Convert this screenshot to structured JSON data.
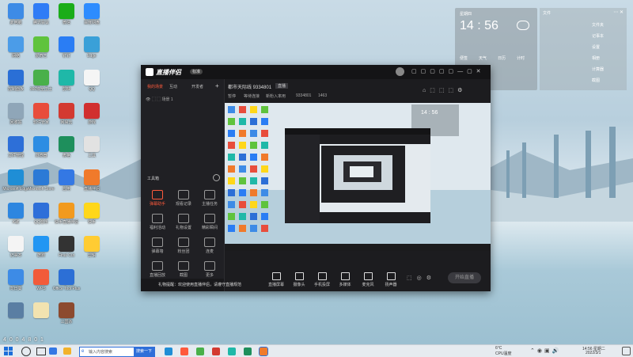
{
  "desktop": {
    "icons": [
      {
        "label": "此电脑",
        "color": "#3d8be6",
        "col": 0,
        "row": 0
      },
      {
        "label": "腾讯会议",
        "color": "#2f7cf6",
        "col": 1,
        "row": 0
      },
      {
        "label": "微信",
        "color": "#1aad19",
        "col": 2,
        "row": 0
      },
      {
        "label": "百度网盘",
        "color": "#2d8cff",
        "col": 3,
        "row": 0
      },
      {
        "label": "网络",
        "color": "#4b9ce8",
        "col": 0,
        "row": 1
      },
      {
        "label": "爱奇艺",
        "color": "#5fc33d",
        "col": 1,
        "row": 1
      },
      {
        "label": "钉钉",
        "color": "#2a7df4",
        "col": 2,
        "row": 1
      },
      {
        "label": "Edge",
        "color": "#3aa0d8",
        "col": 3,
        "row": 1
      },
      {
        "label": "控制面板",
        "color": "#2a6fd6",
        "col": 0,
        "row": 2
      },
      {
        "label": "360安全卫士",
        "color": "#49b04a",
        "col": 1,
        "row": 2
      },
      {
        "label": "剪映",
        "color": "#1fb8a8",
        "col": 2,
        "row": 2
      },
      {
        "label": "QQ",
        "color": "#f5f5f5",
        "col": 3,
        "row": 2
      },
      {
        "label": "回收站",
        "color": "#8fa6b8",
        "col": 0,
        "row": 3
      },
      {
        "label": "软件管家",
        "color": "#e84d3c",
        "col": 1,
        "row": 3
      },
      {
        "label": "网易云",
        "color": "#d33a31",
        "col": 2,
        "row": 3
      },
      {
        "label": "游戏",
        "color": "#d12f2f",
        "col": 3,
        "row": 3
      },
      {
        "label": "文件管理",
        "color": "#2d6fd8",
        "col": 0,
        "row": 4
      },
      {
        "label": "浏览器",
        "color": "#2d8de3",
        "col": 1,
        "row": 4
      },
      {
        "label": "表格",
        "color": "#1e8f5c",
        "col": 2,
        "row": 4
      },
      {
        "label": "工具",
        "color": "#e2e2e2",
        "col": 3,
        "row": 4
      },
      {
        "label": "Microsoft Edge",
        "color": "#1f8ed6",
        "col": 0,
        "row": 5
      },
      {
        "label": "Microsoft Store",
        "color": "#2c7ad6",
        "col": 1,
        "row": 5
      },
      {
        "label": "应用",
        "color": "#3478e4",
        "col": 2,
        "row": 5
      },
      {
        "label": "直播伴侣",
        "color": "#f07a2b",
        "col": 3,
        "row": 5
      },
      {
        "label": "K歌",
        "color": "#2d86e0",
        "col": 0,
        "row": 6
      },
      {
        "label": "QQ音乐",
        "color": "#2e6fd9",
        "col": 1,
        "row": 6
      },
      {
        "label": "快手直播伴侣",
        "color": "#f29a1e",
        "col": 2,
        "row": 6
      },
      {
        "label": "快手",
        "color": "#ffd71a",
        "col": 3,
        "row": 6
      },
      {
        "label": "记事本",
        "color": "#f4f4f4",
        "col": 0,
        "row": 7
      },
      {
        "label": "酷狗",
        "color": "#2196f3",
        "col": 1,
        "row": 7
      },
      {
        "label": "Final Cut",
        "color": "#333333",
        "col": 2,
        "row": 7
      },
      {
        "label": "剪辑",
        "color": "#ffcc33",
        "col": 3,
        "row": 7
      },
      {
        "label": "向日葵",
        "color": "#3d8be6",
        "col": 0,
        "row": 8
      },
      {
        "label": "WPS",
        "color": "#f25b3a",
        "col": 1,
        "row": 8
      },
      {
        "label": "Office Tool Plus",
        "color": "#2c6fd6",
        "col": 2,
        "row": 8
      },
      {
        "label": "",
        "color": "#00000000",
        "col": 3,
        "row": 8
      },
      {
        "label": "",
        "color": "#5a7ea3",
        "col": 0,
        "row": 9
      },
      {
        "label": "",
        "color": "#f2e3b0",
        "col": 1,
        "row": 9
      },
      {
        "label": "三国杀",
        "color": "#8c4a2f",
        "col": 2,
        "row": 9
      }
    ]
  },
  "widget": {
    "date_label": "星期四",
    "time": "14 : 56",
    "items": [
      "便签",
      "天气",
      "日历",
      "计时"
    ]
  },
  "widget2": {
    "title": "文件",
    "items": [
      "文件夹",
      "记事本",
      "设置",
      "相册",
      "计算器",
      "截图"
    ]
  },
  "app": {
    "title": "直播伴侣",
    "badge": "标准",
    "sidebar_tabs": [
      "我的场景",
      "互动",
      "开发者"
    ],
    "scene_label": "场景 1",
    "toolbox_title": "工具箱",
    "tools": [
      "弹幕助手",
      "观看记录",
      "主播任务",
      "福利活动",
      "礼物设置",
      "精彩瞬间",
      "弹幕墙",
      "粉丝团",
      "连麦",
      "直播回放",
      "截图",
      "更多"
    ],
    "notice": "礼物提醒：欢迎使用直播伴侣，请遵守直播规范",
    "room_name": "都市天际线 9334801",
    "room_tag": "直播",
    "room_stats": [
      "暂停",
      "等待连接",
      "新粉入率用",
      "9334801",
      "1463"
    ],
    "controls": [
      "直播屏幕",
      "摄像头",
      "手机投屏",
      "多媒体",
      "麦克风",
      "扬声器"
    ],
    "start_button": "开始直播",
    "preview_time": "14 : 56"
  },
  "taskbar": {
    "search_placeholder": "输入内容搜索",
    "search_button": "搜索一下",
    "weather": "6°C",
    "weather_desc": "CPU温度",
    "time": "14:56 星期二",
    "date": "2022/3/1"
  },
  "watermark": "4 0 0 4 8 0 1"
}
